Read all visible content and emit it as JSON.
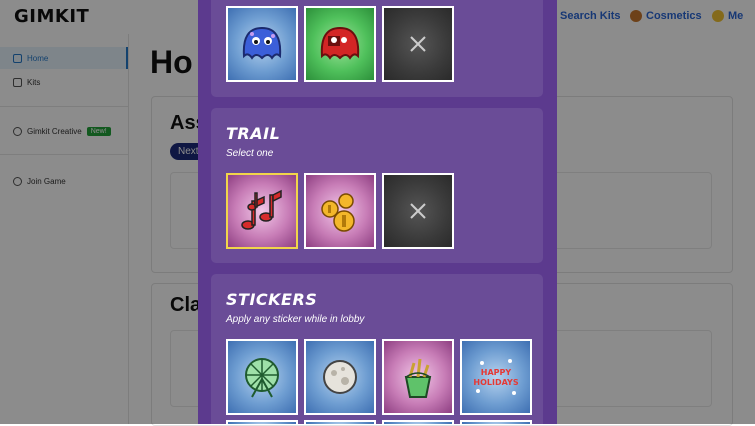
{
  "app": {
    "logo": "GIMKIT",
    "nav": {
      "search_kits": "Search Kits",
      "cosmetics": "Cosmetics",
      "me": "Me"
    }
  },
  "sidebar": {
    "items": [
      {
        "label": "Home",
        "icon": "home-icon",
        "active": true
      },
      {
        "label": "Kits",
        "icon": "kits-icon",
        "active": false
      },
      {
        "label": "Gimkit Creative",
        "icon": "wrench-icon",
        "active": false,
        "badge": "New!"
      },
      {
        "label": "Join Game",
        "icon": "join-icon",
        "active": false
      }
    ]
  },
  "main": {
    "title_partial": "Ho",
    "section1_partial": "Ass",
    "section2_partial": "Cla",
    "next_pill_partial": "Next"
  },
  "modal": {
    "trail": {
      "title": "TRAIL",
      "subtitle": "Select one",
      "items": [
        {
          "name": "music-notes-trail",
          "selected": true,
          "bg": "purple"
        },
        {
          "name": "coins-trail",
          "selected": false,
          "bg": "purple"
        },
        {
          "name": "none",
          "selected": false,
          "bg": "dark"
        }
      ]
    },
    "stickers": {
      "title": "STICKERS",
      "subtitle": "Apply any sticker while in lobby",
      "items": [
        {
          "name": "hamster-wheel-sticker",
          "bg": "blue"
        },
        {
          "name": "moon-sticker",
          "bg": "blue"
        },
        {
          "name": "bucket-sticker",
          "bg": "purple"
        },
        {
          "name": "happy-holidays-sticker",
          "bg": "blue",
          "text_line1": "HAPPY",
          "text_line2": "HOLIDAYS"
        }
      ]
    },
    "top_items": [
      {
        "name": "blue-gim",
        "bg": "blue"
      },
      {
        "name": "red-gim",
        "bg": "green"
      },
      {
        "name": "none",
        "bg": "dark"
      }
    ]
  },
  "colors": {
    "modal_bg": "#5c3a8e",
    "panel_bg": "#6a4c97",
    "selected_border": "#f1d54a",
    "accent_blue": "#2b67d6"
  }
}
